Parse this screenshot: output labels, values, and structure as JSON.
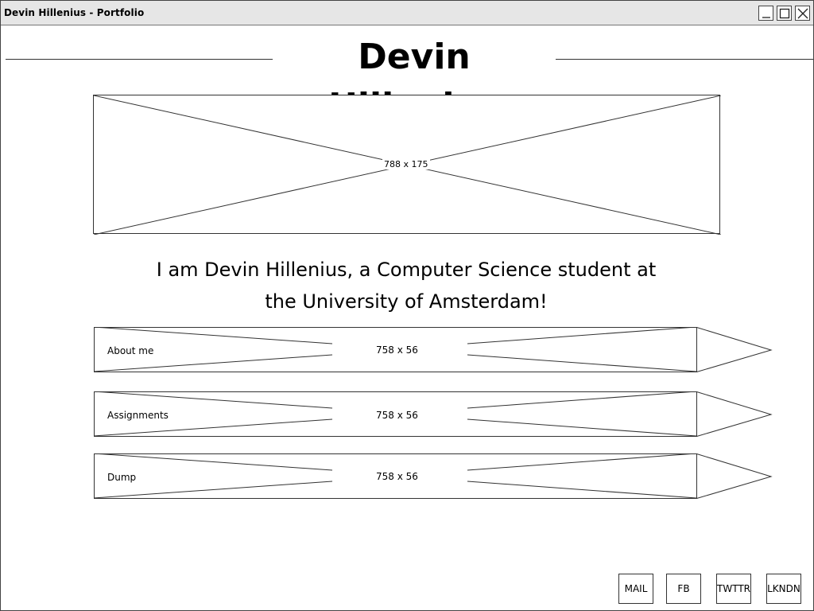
{
  "window": {
    "title": "Devin Hillenius - Portfolio"
  },
  "header": {
    "title": "Devin Hillenius"
  },
  "banner": {
    "dimension_label": "788 x 175"
  },
  "intro": {
    "line1": "I am Devin Hillenius, a Computer Science student at",
    "line2": "the University of Amsterdam!"
  },
  "nav": {
    "items": [
      {
        "label": "About me",
        "dimension_label": "758 x 56"
      },
      {
        "label": "Assignments",
        "dimension_label": "758 x 56"
      },
      {
        "label": "Dump",
        "dimension_label": "758 x 56"
      }
    ]
  },
  "social": {
    "buttons": [
      {
        "label": "MAIL"
      },
      {
        "label": "FB"
      },
      {
        "label": "TWTTR"
      },
      {
        "label": "LKNDN"
      }
    ]
  },
  "colors": {
    "titlebar": "#e6e6e6",
    "stroke": "#333333",
    "background": "#ffffff"
  }
}
